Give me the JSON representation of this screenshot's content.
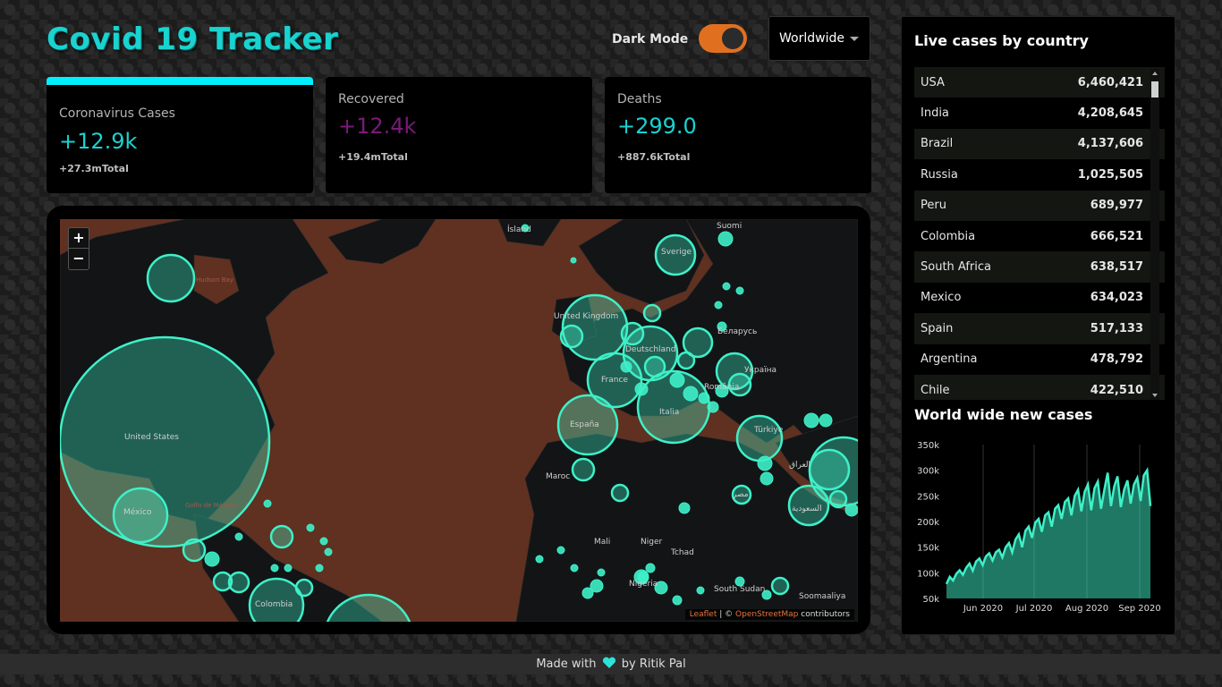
{
  "header": {
    "title": "Covid 19 Tracker",
    "dark_mode_label": "Dark Mode",
    "dark_mode_on": true,
    "region_select": "Worldwide"
  },
  "cards": [
    {
      "label": "Coronavirus Cases",
      "value": "+12.9k",
      "total": "+27.3mTotal",
      "active": true,
      "color": "#19d3d0"
    },
    {
      "label": "Recovered",
      "value": "+12.4k",
      "total": "+19.4mTotal",
      "active": false,
      "color": "#7a1a7a"
    },
    {
      "label": "Deaths",
      "value": "+299.0",
      "total": "+887.6kTotal",
      "active": false,
      "color": "#19d3d0"
    }
  ],
  "map": {
    "zoom_in": "+",
    "zoom_out": "−",
    "attribution_leaflet": "Leaflet",
    "attribution_sep": " | © ",
    "attribution_osm": "OpenStreetMap",
    "attribution_tail": " contributors",
    "labels": [
      "Ísland",
      "Suomi",
      "Sverige",
      "Hudson Bay",
      "United Kingdom",
      "Deutschland",
      "Беларусь",
      "Україна",
      "France",
      "Italia",
      "România",
      "España",
      "Türkiye",
      "United States",
      "México",
      "Golfo de México",
      "Maroc",
      "العراق",
      "مصر",
      "السعودية",
      "Mali",
      "Niger",
      "Tchad",
      "Nigeria",
      "South Sudan",
      "Soomaaliya",
      "Colombia"
    ],
    "circle_color": "#3ef0c8"
  },
  "live_cases": {
    "title": "Live cases by country",
    "rows": [
      {
        "country": "USA",
        "cases": "6,460,421"
      },
      {
        "country": "India",
        "cases": "4,208,645"
      },
      {
        "country": "Brazil",
        "cases": "4,137,606"
      },
      {
        "country": "Russia",
        "cases": "1,025,505"
      },
      {
        "country": "Peru",
        "cases": "689,977"
      },
      {
        "country": "Colombia",
        "cases": "666,521"
      },
      {
        "country": "South Africa",
        "cases": "638,517"
      },
      {
        "country": "Mexico",
        "cases": "634,023"
      },
      {
        "country": "Spain",
        "cases": "517,133"
      },
      {
        "country": "Argentina",
        "cases": "478,792"
      },
      {
        "country": "Chile",
        "cases": "422,510"
      }
    ]
  },
  "chart_data": {
    "type": "area",
    "title": "World wide new cases",
    "ylim": [
      50000,
      350000
    ],
    "y_ticks": [
      "350k",
      "300k",
      "250k",
      "200k",
      "150k",
      "100k",
      "50k"
    ],
    "x_ticks": [
      "Jun 2020",
      "Jul 2020",
      "Aug 2020",
      "Sep 2020"
    ],
    "values": [
      78000,
      92000,
      85000,
      98000,
      105000,
      96000,
      110000,
      118000,
      104000,
      122000,
      128000,
      115000,
      132000,
      138000,
      124000,
      140000,
      145000,
      130000,
      150000,
      158000,
      140000,
      165000,
      175000,
      150000,
      182000,
      190000,
      168000,
      198000,
      205000,
      180000,
      212000,
      218000,
      190000,
      225000,
      232000,
      205000,
      238000,
      245000,
      212000,
      250000,
      262000,
      220000,
      258000,
      272000,
      222000,
      265000,
      278000,
      225000,
      262000,
      295000,
      230000,
      268000,
      288000,
      228000,
      262000,
      280000,
      235000,
      272000,
      285000,
      240000,
      290000,
      300000,
      230000
    ],
    "color": "#3ef0c8"
  },
  "footer": {
    "made_with": "Made with",
    "by": "by Ritik Pal"
  }
}
